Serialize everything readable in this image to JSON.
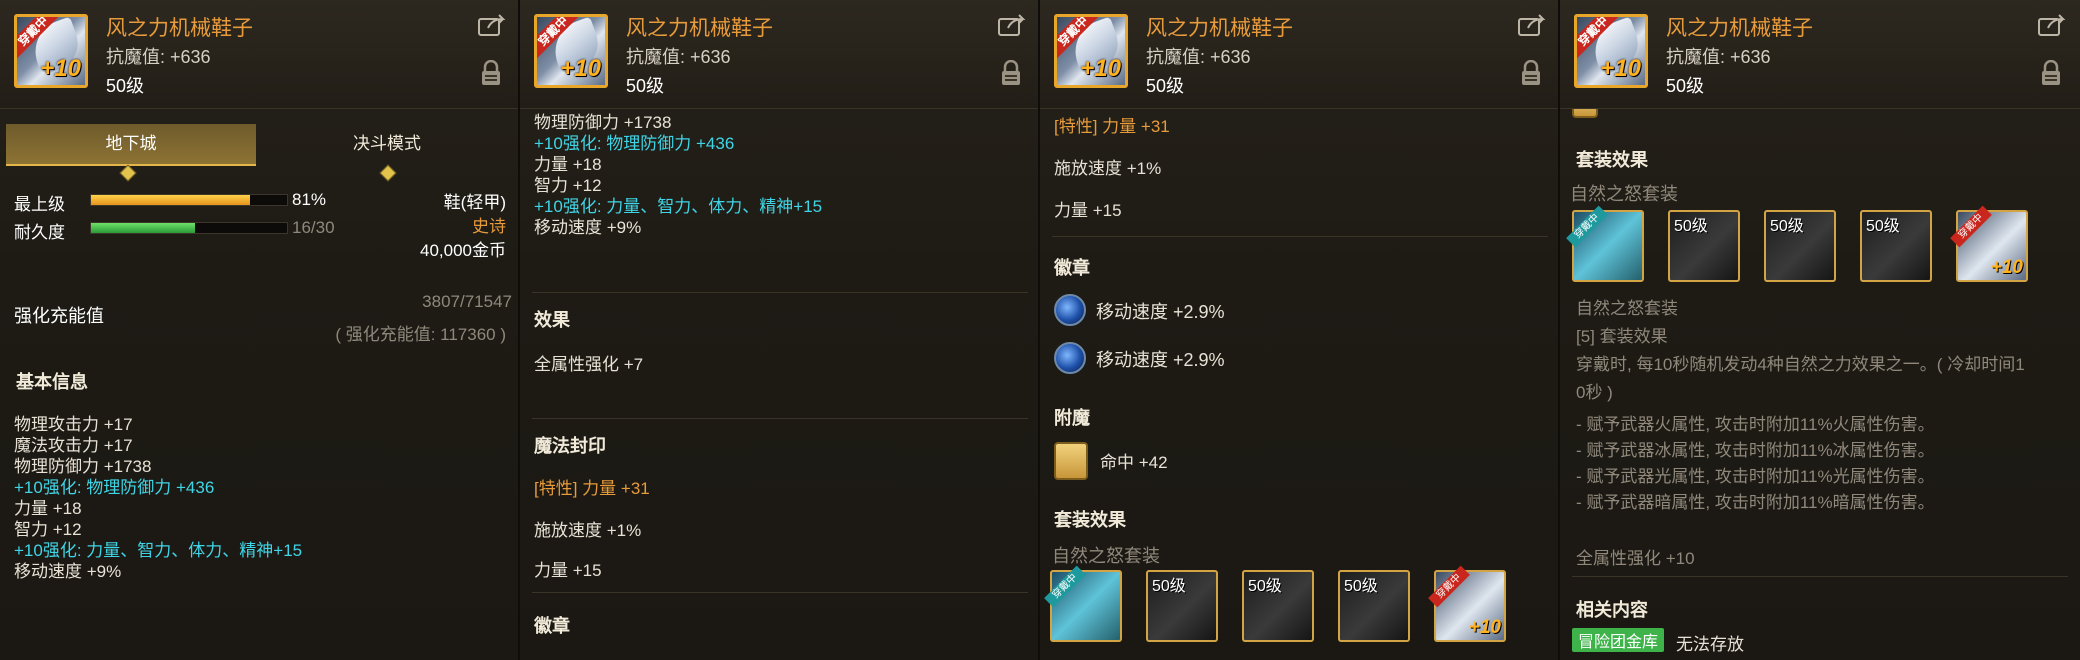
{
  "item": {
    "name": "风之力机械鞋子",
    "stat": "抗魔值: +636",
    "level": "50级",
    "badge": "穿戴中",
    "enhance": "+10",
    "icon": "mechanical-shoe-icon"
  },
  "panel1": {
    "tabs": [
      "地下城",
      "决斗模式"
    ],
    "grade_label": "最上级",
    "grade_value": "81%",
    "grade_fraction": 0.81,
    "durability_label": "耐久度",
    "durability_value": "16/30",
    "durability_fraction": 0.533,
    "type": "鞋(轻甲)",
    "rarity": "史诗",
    "price": "40,000金币",
    "charge_title": "强化充能值",
    "charge_value": "3807/71547",
    "charge_note": "( 强化充能值: 117360 )",
    "basic_title": "基本信息",
    "stats": [
      {
        "text": "物理攻击力 +17",
        "kind": "normal"
      },
      {
        "text": "魔法攻击力 +17",
        "kind": "normal"
      },
      {
        "text": "物理防御力 +1738",
        "kind": "normal"
      },
      {
        "text": "+10强化: 物理防御力 +436",
        "kind": "cyan"
      },
      {
        "text": "力量 +18",
        "kind": "normal"
      },
      {
        "text": "智力 +12",
        "kind": "normal"
      },
      {
        "text": "+10强化: 力量、智力、体力、精神+15",
        "kind": "cyan"
      },
      {
        "text": "移动速度 +9%",
        "kind": "normal"
      }
    ]
  },
  "panel2": {
    "stats": [
      {
        "text": "物理防御力 +1738",
        "kind": "normal"
      },
      {
        "text": "+10强化: 物理防御力 +436",
        "kind": "cyan"
      },
      {
        "text": "力量 +18",
        "kind": "normal"
      },
      {
        "text": "智力 +12",
        "kind": "normal"
      },
      {
        "text": "+10强化: 力量、智力、体力、精神+15",
        "kind": "cyan"
      },
      {
        "text": "移动速度 +9%",
        "kind": "normal"
      }
    ],
    "effect_title": "效果",
    "effect_text": "全属性强化 +7",
    "seal_title": "魔法封印",
    "seal_lines": [
      "[特性] 力量 +31",
      "施放速度 +1%",
      "力量 +15"
    ],
    "emblem_title": "徽章"
  },
  "panel3": {
    "seal_lines": [
      "[特性] 力量 +31",
      "施放速度 +1%",
      "力量 +15"
    ],
    "emblem_title": "徽章",
    "emblems": [
      "移动速度 +2.9%",
      "移动速度 +2.9%"
    ],
    "enchant_title": "附魔",
    "enchant_text": "命中 +42",
    "set_title": "套装效果",
    "set_name": "自然之怒套装",
    "slot_levels": [
      "",
      "50级",
      "50级",
      "50级",
      ""
    ]
  },
  "panel4": {
    "set_title": "套装效果",
    "set_name": "自然之怒套装",
    "slot_levels": [
      "",
      "50级",
      "50级",
      "50级",
      ""
    ],
    "set_name2": "自然之怒套装",
    "set_effect_title": "[5] 套装效果",
    "set_desc": "穿戴时, 每10秒随机发动4种自然之力效果之一。( 冷却时间1",
    "set_desc2": "0秒 )",
    "bullets": [
      "- 赋予武器火属性, 攻击时附加11%火属性伤害。",
      "- 赋予武器冰属性, 攻击时附加11%冰属性伤害。",
      "- 赋予武器光属性, 攻击时附加11%光属性伤害。",
      "- 赋予武器暗属性, 攻击时附加11%暗属性伤害。"
    ],
    "all_stat": "全属性强化 +10",
    "related_title": "相关内容",
    "related_tag": "冒险团金库",
    "related_text": "无法存放"
  },
  "colors": {
    "accent": "#e79b3b",
    "cyan": "#3fd5e6",
    "grade_bar": "#f0a82a",
    "durability_bar": "#3bb84a"
  }
}
